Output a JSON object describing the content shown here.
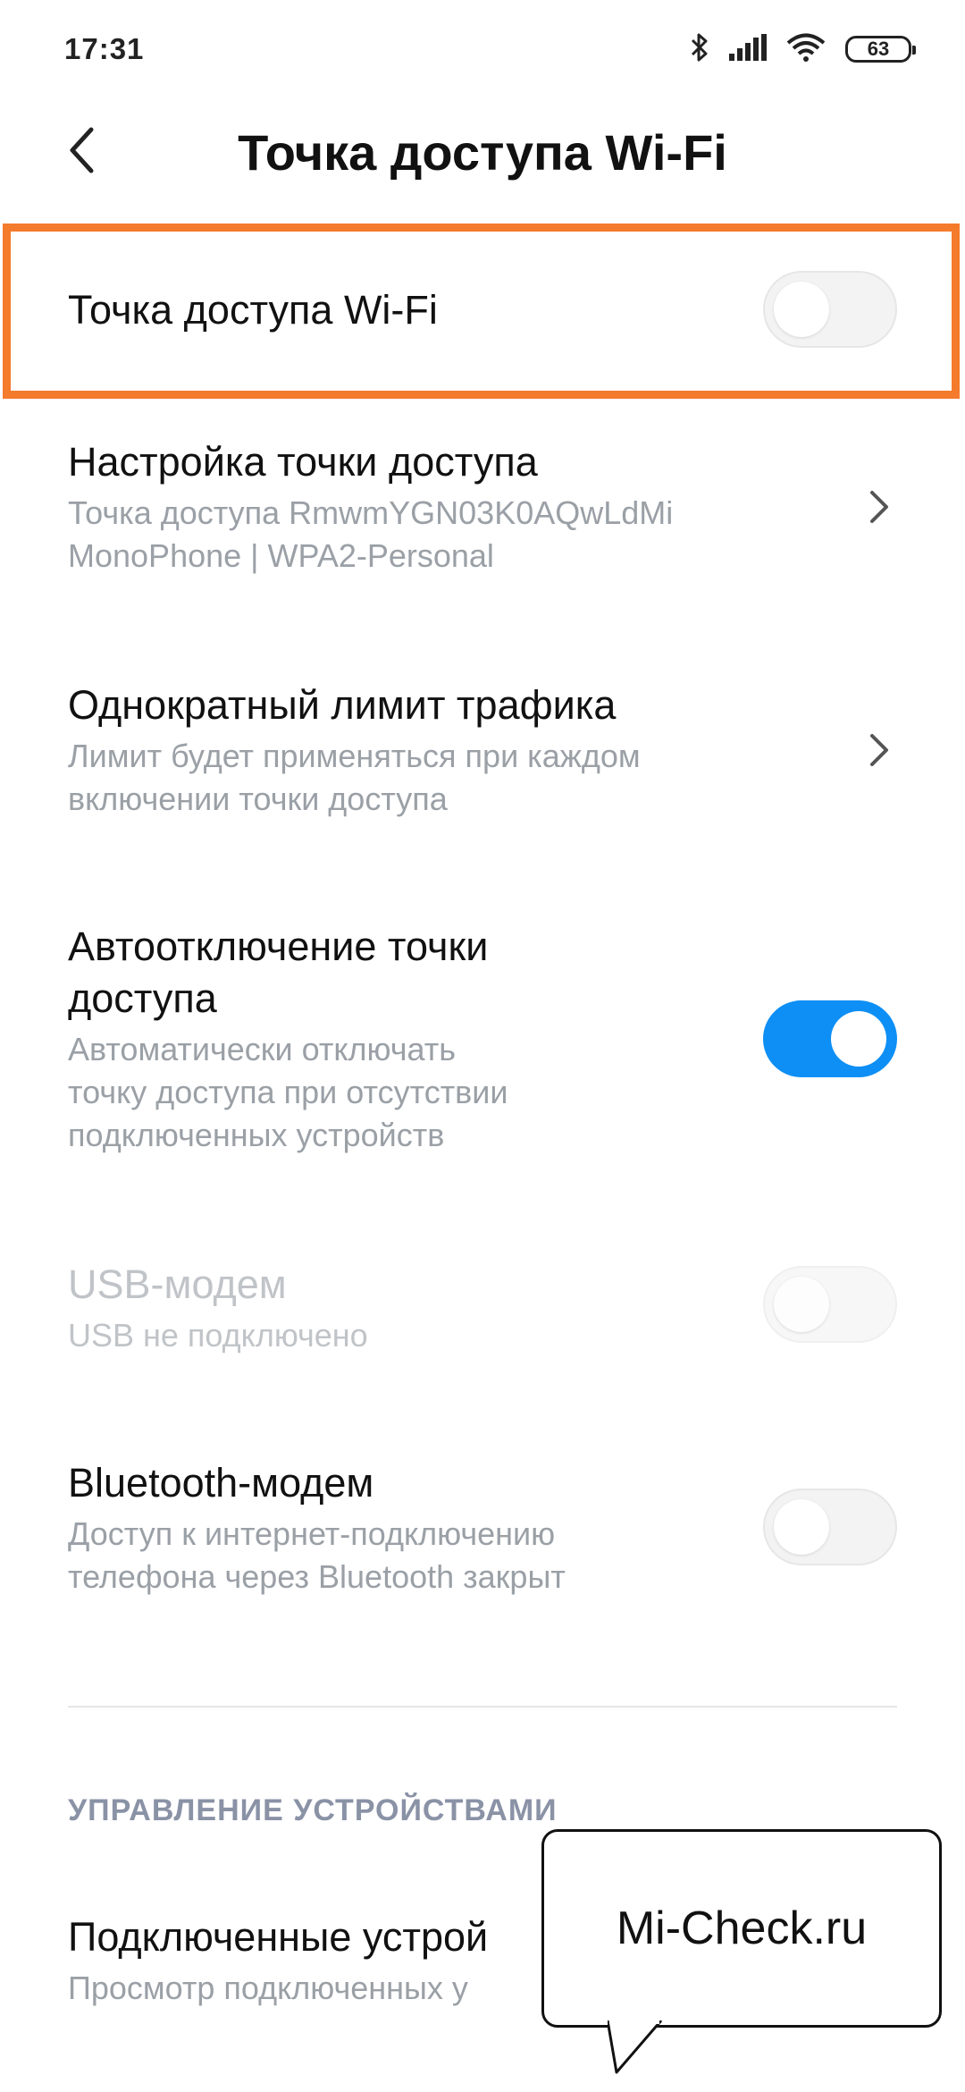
{
  "status_bar": {
    "time": "17:31",
    "battery": "63",
    "icons": [
      "bluetooth-icon",
      "signal-icon",
      "wifi-icon",
      "battery-icon"
    ]
  },
  "header": {
    "title": "Точка доступа Wi-Fi",
    "back_icon": "chevron-left-icon"
  },
  "settings": {
    "hotspot": {
      "title": "Точка доступа Wi-Fi",
      "enabled": false
    },
    "hotspot_setup": {
      "title": "Настройка точки доступа",
      "subtitle_line1": "Точка доступа RmwmYGN03K0AQwLdMi",
      "subtitle_line2": "MonoPhone | WPA2-Personal"
    },
    "traffic_limit": {
      "title": "Однократный лимит трафика",
      "subtitle_line1": "Лимит будет применяться при каждом",
      "subtitle_line2": "включении точки доступа"
    },
    "auto_off": {
      "title_line1": "Автоотключение точки",
      "title_line2": "доступа",
      "subtitle_line1": "Автоматически отключать",
      "subtitle_line2": "точку доступа при отсутствии",
      "subtitle_line3": "подключенных устройств",
      "enabled": true
    },
    "usb_modem": {
      "title": "USB-модем",
      "subtitle": "USB не подключено",
      "enabled": false,
      "disabled": true
    },
    "bt_modem": {
      "title": "Bluetooth-модем",
      "subtitle_line1": "Доступ к интернет-подключению",
      "subtitle_line2": "телефона через Bluetooth закрыт",
      "enabled": false
    }
  },
  "devices_section": {
    "label": "УПРАВЛЕНИЕ УСТРОЙСТВАМИ",
    "connected": {
      "title": "Подключенные устрой",
      "subtitle": "Просмотр подключенных у"
    }
  },
  "watermark": {
    "text": "Mi-Check.ru"
  },
  "colors": {
    "accent": "#0d8ff5",
    "highlight_border": "#f47a2c",
    "subtitle": "#9aa0a6",
    "section_label": "#8a92a6"
  }
}
